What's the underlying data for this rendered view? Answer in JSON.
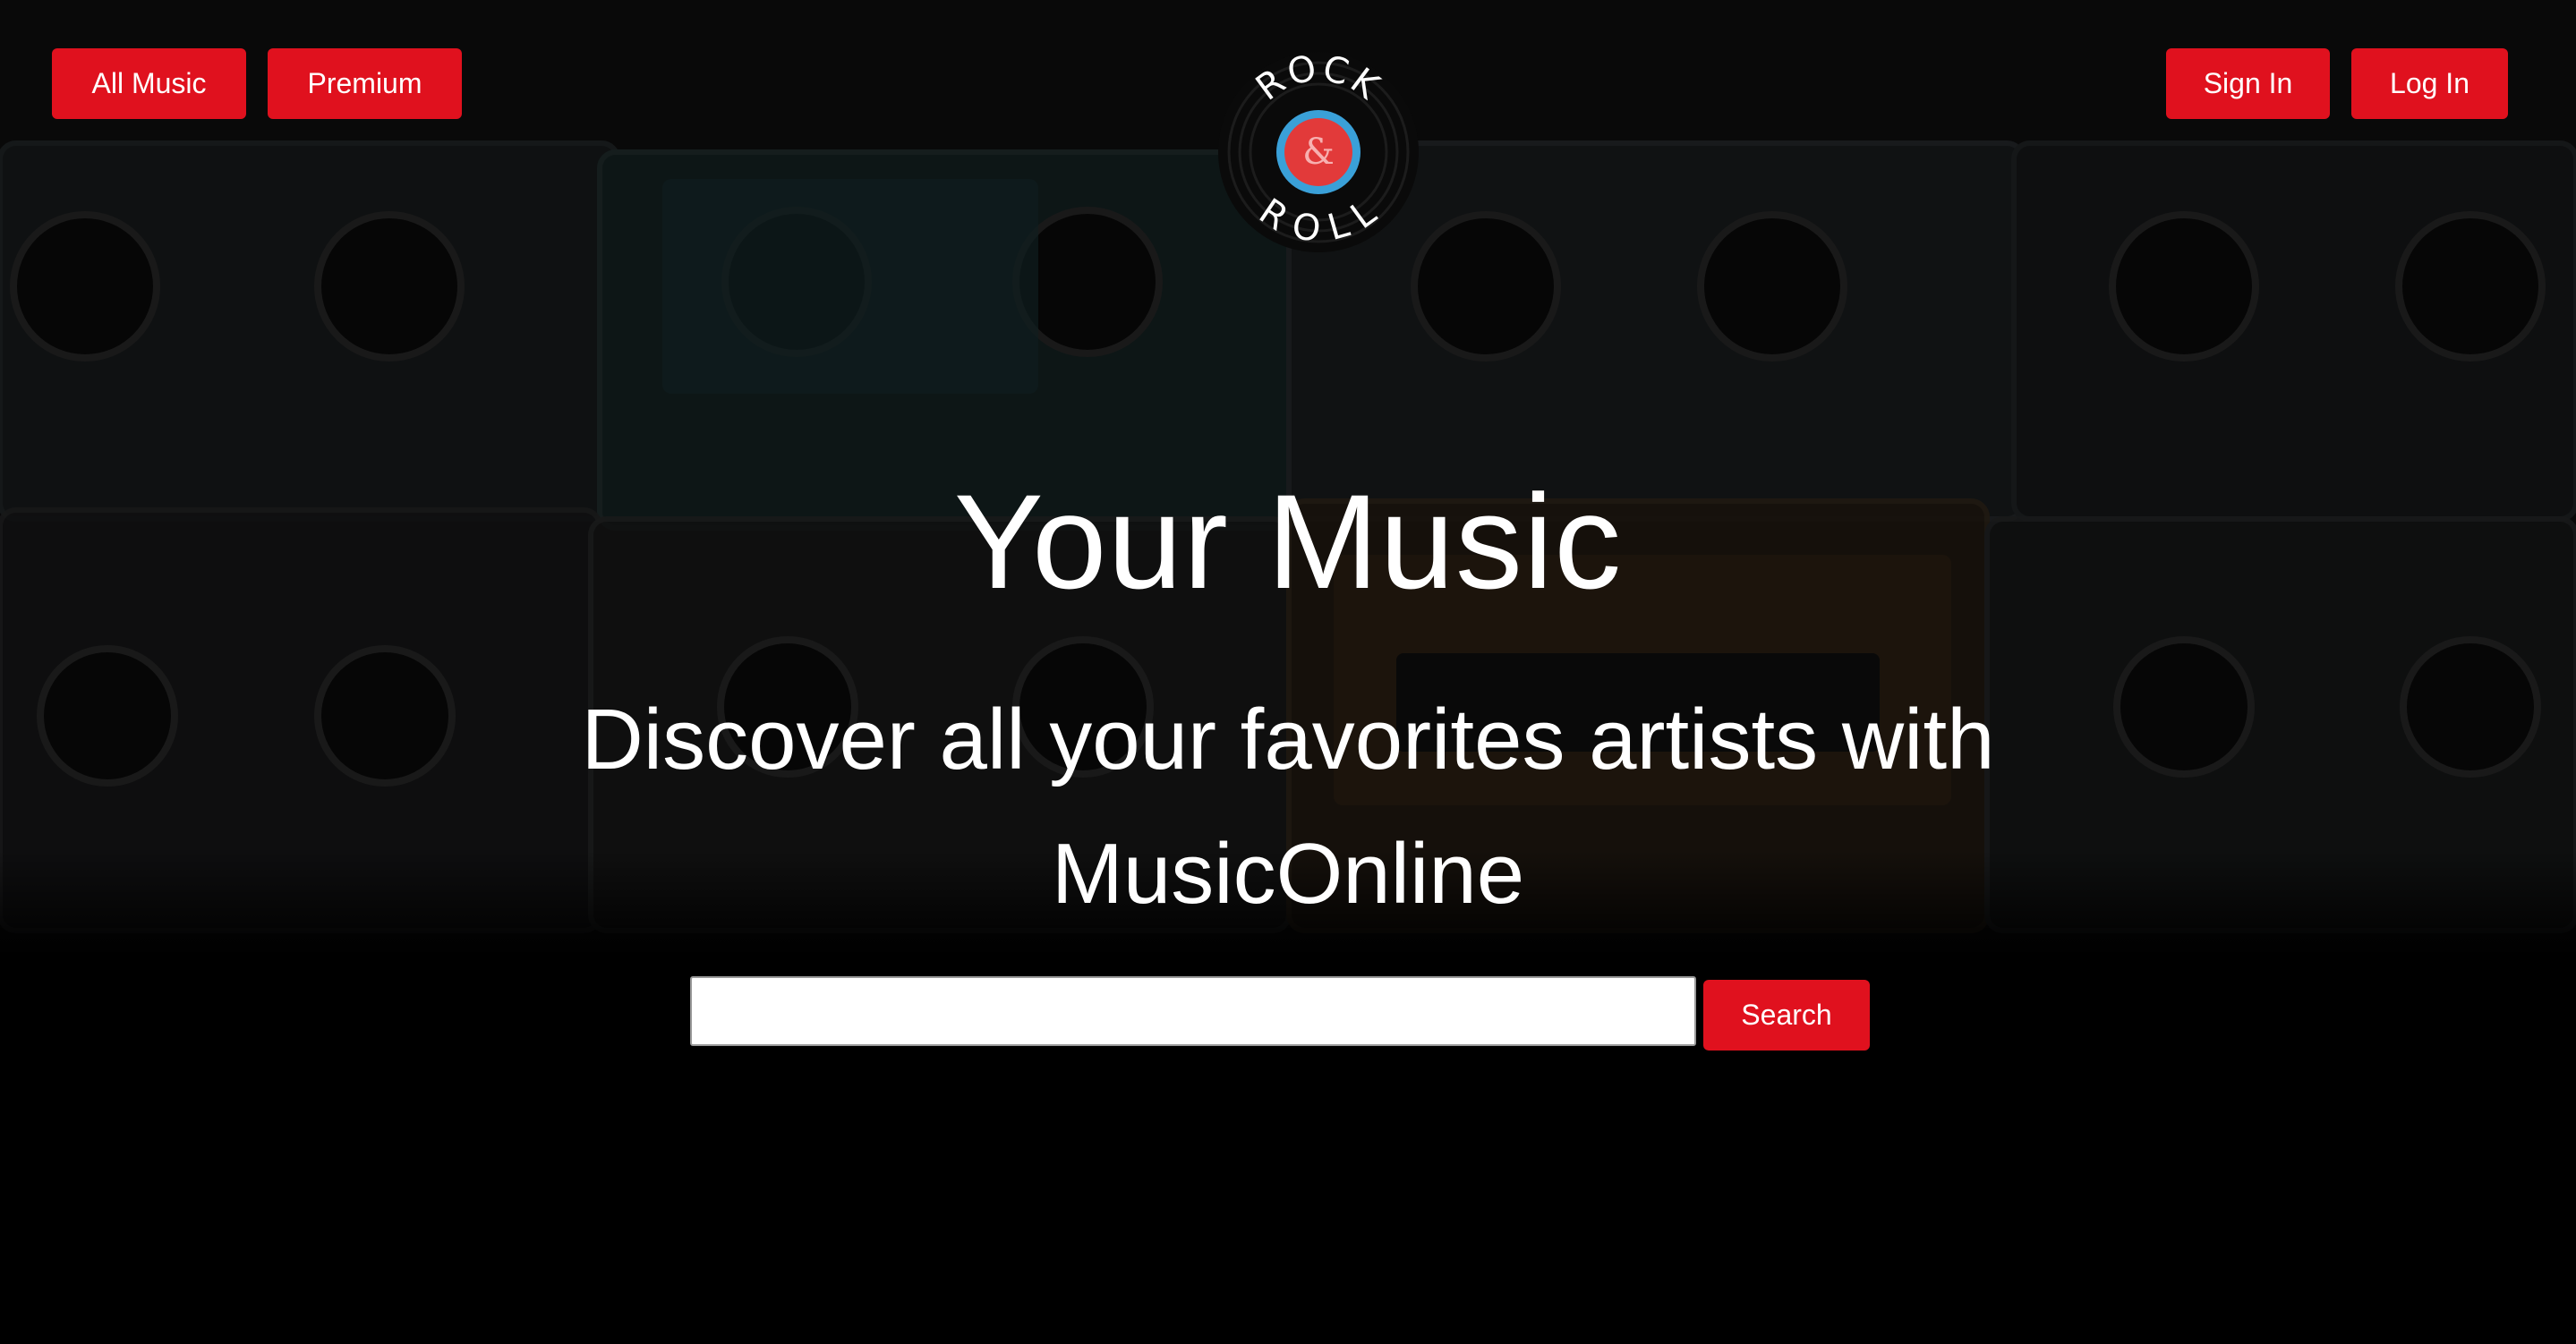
{
  "nav": {
    "all_music": "All Music",
    "premium": "Premium",
    "sign_in": "Sign In",
    "log_in": "Log In"
  },
  "logo": {
    "top_text": "ROCK",
    "middle_text": "&",
    "bottom_text": "ROLL"
  },
  "hero": {
    "title": "Your Music",
    "subtitle": "Discover all your favorites artists with MusicOnline"
  },
  "search": {
    "value": "",
    "placeholder": "",
    "button_label": "Search"
  },
  "colors": {
    "accent": "#e0111e",
    "background": "#000000",
    "text": "#ffffff"
  }
}
